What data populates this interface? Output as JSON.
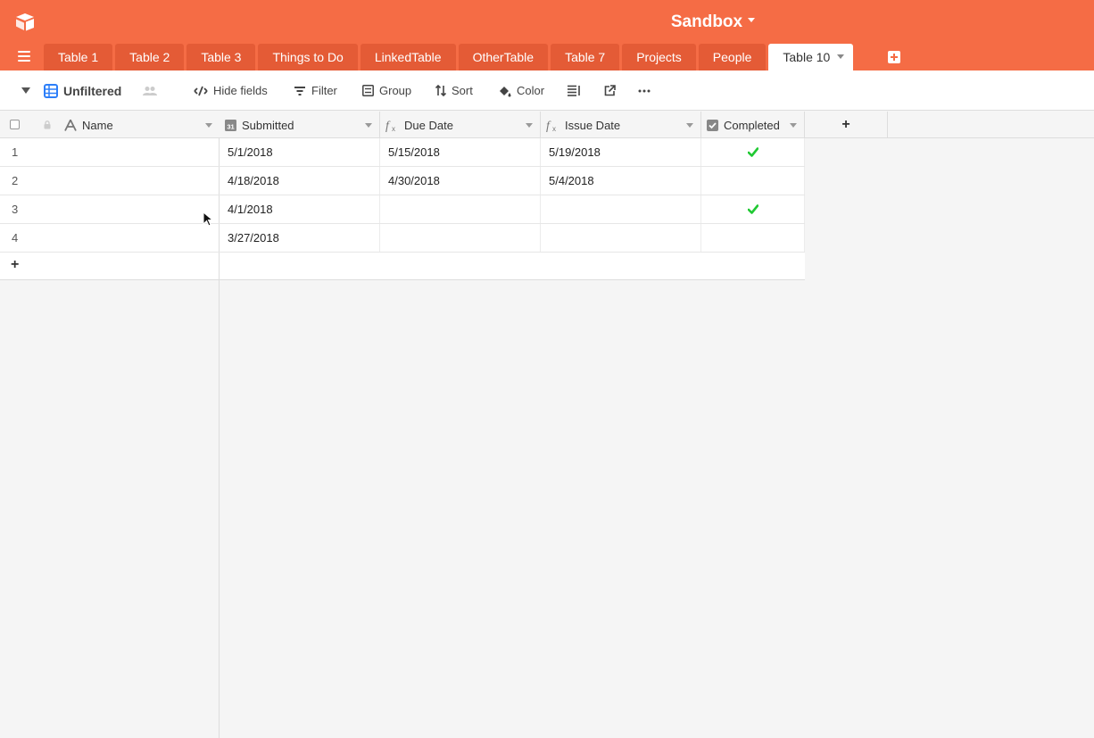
{
  "app": {
    "base_title": "Sandbox"
  },
  "tabs": [
    {
      "label": "Table 1"
    },
    {
      "label": "Table 2"
    },
    {
      "label": "Table 3"
    },
    {
      "label": "Things to Do"
    },
    {
      "label": "LinkedTable"
    },
    {
      "label": "OtherTable"
    },
    {
      "label": "Table 7"
    },
    {
      "label": "Projects"
    },
    {
      "label": "People"
    },
    {
      "label": "Table 10"
    }
  ],
  "toolbar": {
    "view_name": "Unfiltered",
    "hide_fields": "Hide fields",
    "filter": "Filter",
    "group": "Group",
    "sort": "Sort",
    "color": "Color"
  },
  "columns": [
    {
      "label": "Name",
      "icon": "text-icon"
    },
    {
      "label": "Submitted",
      "icon": "calendar-icon"
    },
    {
      "label": "Due Date",
      "icon": "formula-icon"
    },
    {
      "label": "Issue Date",
      "icon": "formula-icon"
    },
    {
      "label": "Completed",
      "icon": "checkbox-icon"
    }
  ],
  "rows": [
    {
      "num": "1",
      "name": "",
      "submitted": "5/1/2018",
      "due": "5/15/2018",
      "issue": "5/19/2018",
      "completed": true
    },
    {
      "num": "2",
      "name": "",
      "submitted": "4/18/2018",
      "due": "4/30/2018",
      "issue": "5/4/2018",
      "completed": false
    },
    {
      "num": "3",
      "name": "",
      "submitted": "4/1/2018",
      "due": "",
      "issue": "",
      "completed": true
    },
    {
      "num": "4",
      "name": "",
      "submitted": "3/27/2018",
      "due": "",
      "issue": "",
      "completed": false
    }
  ],
  "colors": {
    "header": "#f56c45",
    "tab": "#e45b36",
    "check": "#20c933",
    "view_icon": "#2d7ff9"
  }
}
